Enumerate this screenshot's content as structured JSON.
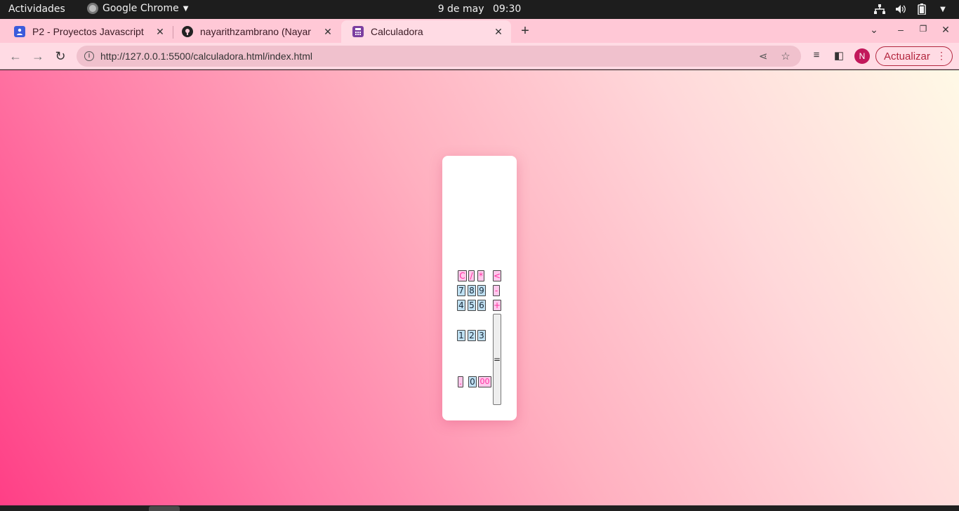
{
  "system_bar": {
    "activities": "Actividades",
    "app_name": "Google Chrome",
    "date": "9 de may",
    "time": "09:30"
  },
  "tabs": [
    {
      "title": "P2 - Proyectos Javascript",
      "favicon": "person-card-icon",
      "color": "#3b5bdb"
    },
    {
      "title": "nayarithzambrano (Nayar",
      "favicon": "github-icon",
      "color": "#222222"
    },
    {
      "title": "Calculadora",
      "favicon": "calculator-icon",
      "color": "#7b3fa0"
    }
  ],
  "address_bar": {
    "url": "http://127.0.0.1:5500/calculadora.html/index.html"
  },
  "profile_initial": "N",
  "update_label": "Actualizar",
  "calculator": {
    "display": "",
    "keys": {
      "clear": "C",
      "divide": "/",
      "multiply": "*",
      "backspace": "<",
      "seven": "7",
      "eight": "8",
      "nine": "9",
      "minus": "-",
      "four": "4",
      "five": "5",
      "six": "6",
      "plus": "+",
      "one": "1",
      "two": "2",
      "three": "3",
      "equals": "=",
      "decimal": ".",
      "zero": "0",
      "double_zero": "00"
    }
  },
  "colors": {
    "accent": "#b3263e",
    "number_key": "#bfe0f2",
    "operator_key": "#ffc8ec",
    "operator_text": "#ff2fa0"
  }
}
